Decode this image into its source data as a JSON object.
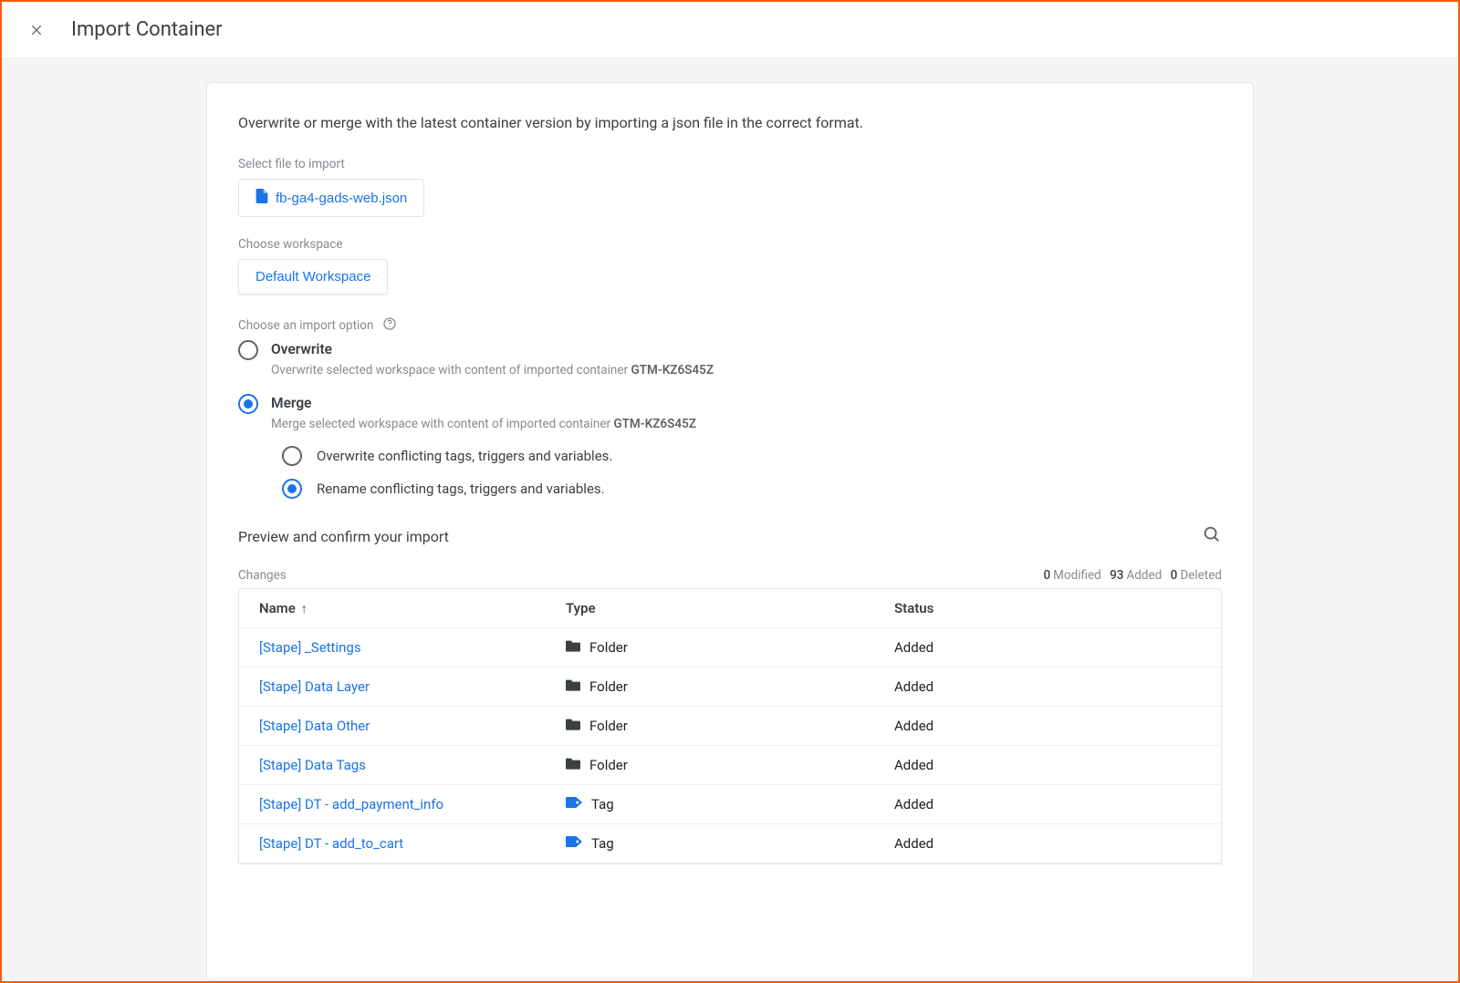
{
  "header": {
    "title": "Import Container"
  },
  "description": "Overwrite or merge with the latest container version by importing a json file in the correct format.",
  "file": {
    "label": "Select file to import",
    "name": "fb-ga4-gads-web.json"
  },
  "workspace": {
    "label": "Choose workspace",
    "name": "Default Workspace"
  },
  "importOption": {
    "label": "Choose an import option",
    "container_id": "GTM-KZ6S45Z",
    "overwrite": {
      "title": "Overwrite",
      "desc_prefix": "Overwrite selected workspace with content of imported container "
    },
    "merge": {
      "title": "Merge",
      "desc_prefix": "Merge selected workspace with content of imported container ",
      "sub_overwrite": "Overwrite conflicting tags, triggers and variables.",
      "sub_rename": "Rename conflicting tags, triggers and variables."
    }
  },
  "preview": {
    "title": "Preview and confirm your import",
    "changes_label": "Changes",
    "stats": {
      "modified": 0,
      "added": 93,
      "deleted": 0
    },
    "stats_labels": {
      "modified": "Modified",
      "added": "Added",
      "deleted": "Deleted"
    },
    "cols": {
      "name": "Name",
      "type": "Type",
      "status": "Status"
    },
    "rows": [
      {
        "name": "[Stape] _Settings",
        "type": "Folder",
        "status": "Added",
        "icon": "folder"
      },
      {
        "name": "[Stape] Data Layer",
        "type": "Folder",
        "status": "Added",
        "icon": "folder"
      },
      {
        "name": "[Stape] Data Other",
        "type": "Folder",
        "status": "Added",
        "icon": "folder"
      },
      {
        "name": "[Stape] Data Tags",
        "type": "Folder",
        "status": "Added",
        "icon": "folder"
      },
      {
        "name": "[Stape] DT - add_payment_info",
        "type": "Tag",
        "status": "Added",
        "icon": "tag"
      },
      {
        "name": "[Stape] DT - add_to_cart",
        "type": "Tag",
        "status": "Added",
        "icon": "tag"
      }
    ]
  }
}
